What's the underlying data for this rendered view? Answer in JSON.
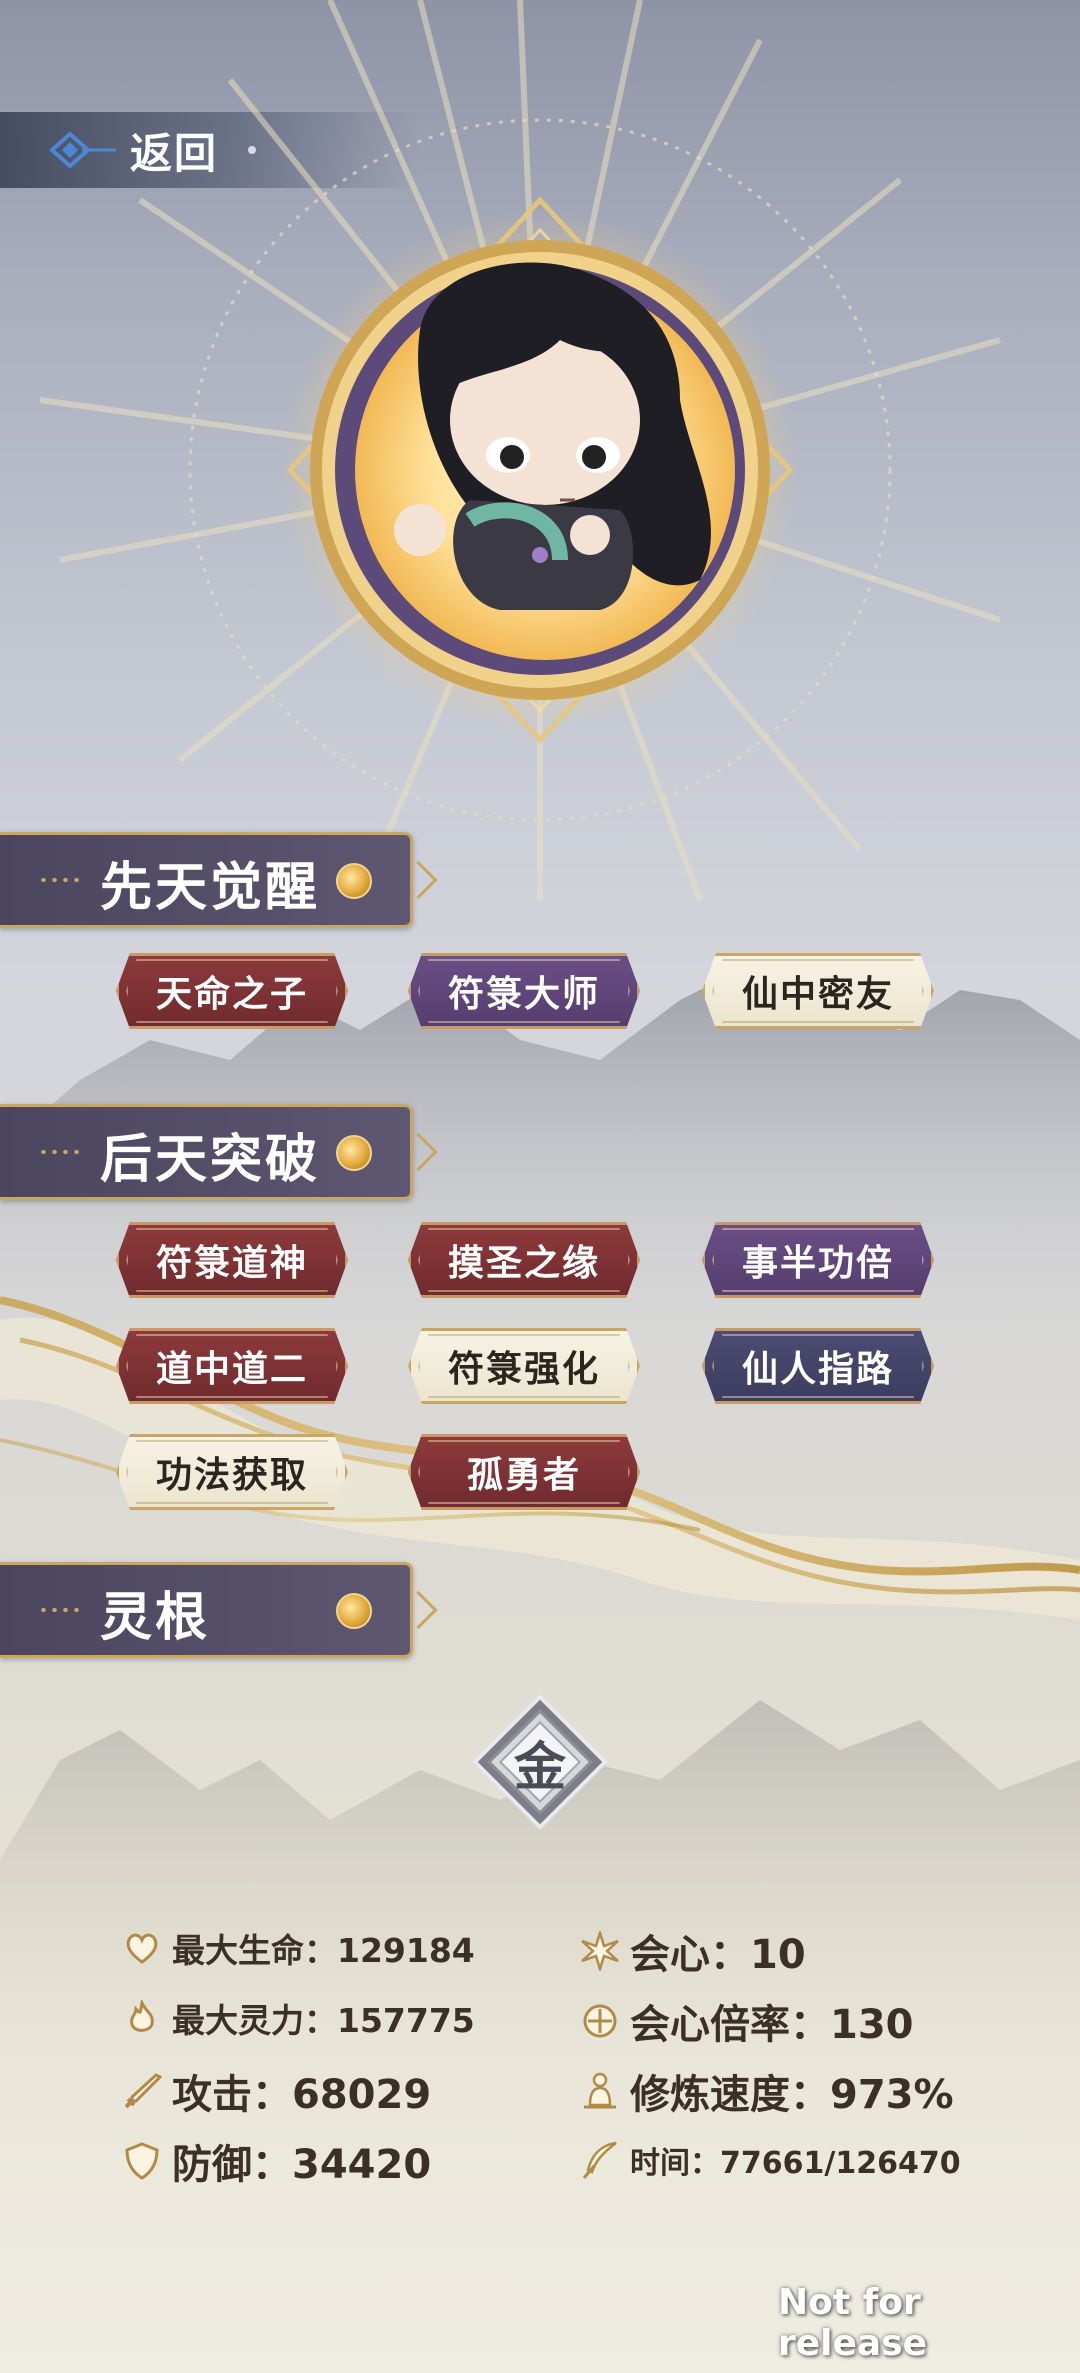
{
  "nav": {
    "back_label": "返回"
  },
  "sections": {
    "innate": {
      "title": "先天觉醒"
    },
    "acquired": {
      "title": "后天突破"
    },
    "root": {
      "title": "灵根"
    }
  },
  "innate_tags": [
    {
      "label": "天命之子",
      "style": "red"
    },
    {
      "label": "符箓大师",
      "style": "purple"
    },
    {
      "label": "仙中密友",
      "style": "cream"
    }
  ],
  "acquired_tags": [
    {
      "label": "符箓道神",
      "style": "red"
    },
    {
      "label": "摸圣之缘",
      "style": "red"
    },
    {
      "label": "事半功倍",
      "style": "purple"
    },
    {
      "label": "道中道二",
      "style": "red"
    },
    {
      "label": "符箓强化",
      "style": "cream"
    },
    {
      "label": "仙人指路",
      "style": "navy"
    },
    {
      "label": "功法获取",
      "style": "cream"
    },
    {
      "label": "孤勇者",
      "style": "red"
    }
  ],
  "root": {
    "element": "金"
  },
  "stats": {
    "max_hp": "最大生命：129184",
    "max_mp": "最大灵力：157775",
    "attack": "攻击：68029",
    "defense": "防御：34420",
    "crit": "会心：10",
    "crit_mult": "会心倍率：130",
    "cultivate_speed": "修炼速度：973%",
    "time": "时间：77661/126470"
  },
  "watermark": "Not for release",
  "colors": {
    "gold": "#c9a664",
    "tag_red": "#7f3335",
    "tag_purple": "#5f4679",
    "tag_navy": "#444468",
    "tag_cream": "#f2eedd",
    "section_bg": "#524c66"
  }
}
